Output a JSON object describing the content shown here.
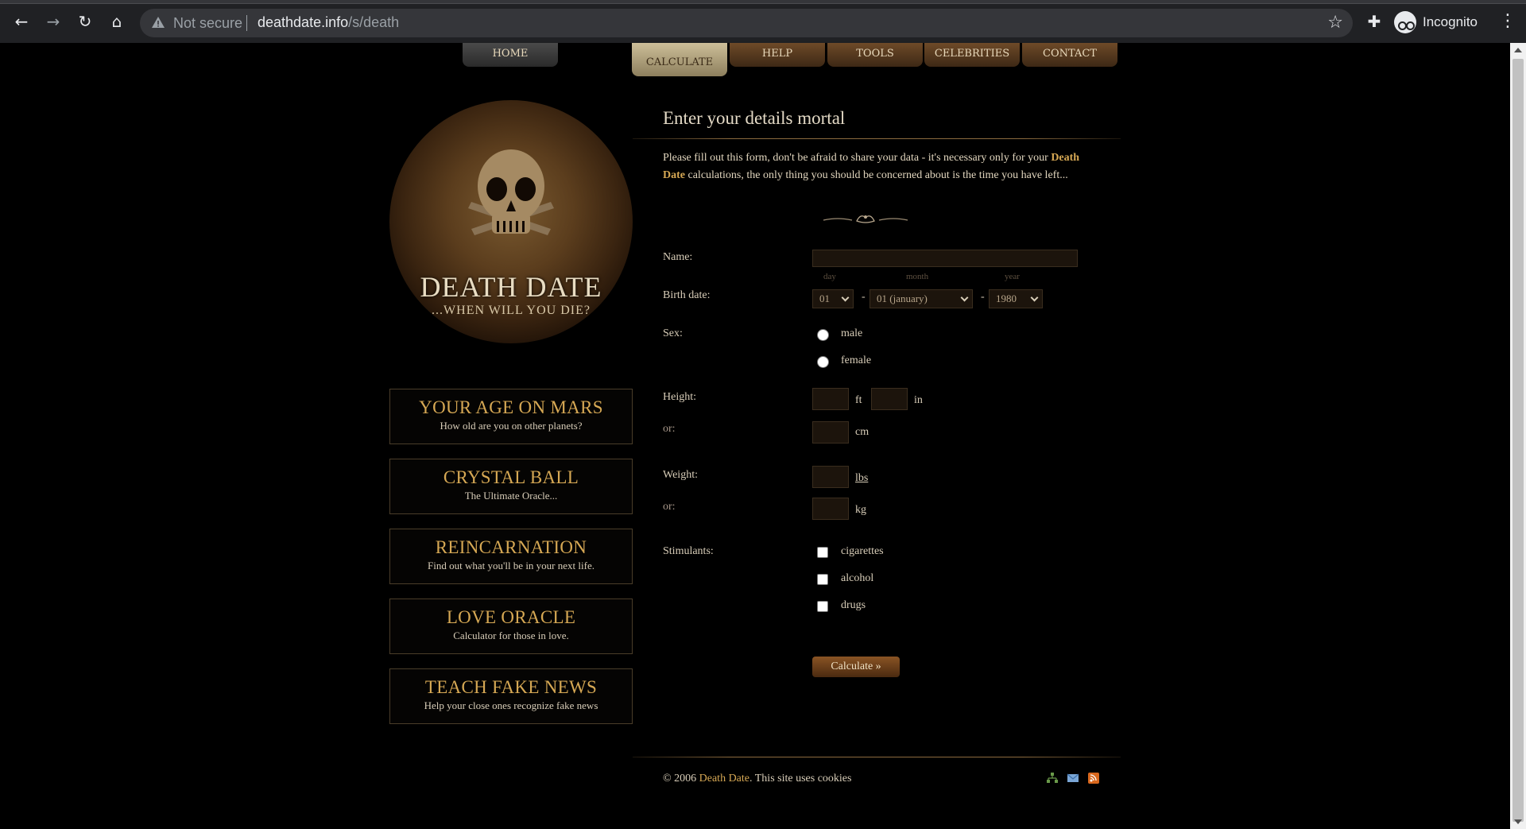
{
  "browser": {
    "security_label": "Not secure",
    "url_domain": "deathdate.info",
    "url_path": "/s/death",
    "profile_label": "Incognito"
  },
  "nav": {
    "tabs": [
      {
        "label": "HOME"
      },
      {
        "label": "CALCULATE"
      },
      {
        "label": "HELP"
      },
      {
        "label": "TOOLS"
      },
      {
        "label": "CELEBRITIES"
      },
      {
        "label": "CONTACT"
      }
    ]
  },
  "logo": {
    "title": "DEATH DATE",
    "subtitle": "...WHEN WILL YOU DIE?"
  },
  "promos": [
    {
      "title": "YOUR AGE ON MARS",
      "subtitle": "How old are you on other planets?"
    },
    {
      "title": "CRYSTAL BALL",
      "subtitle": "The Ultimate Oracle..."
    },
    {
      "title": "REINCARNATION",
      "subtitle": "Find out what you'll be in your next life."
    },
    {
      "title": "LOVE ORACLE",
      "subtitle": "Calculator for those in love."
    },
    {
      "title": "TEACH FAKE NEWS",
      "subtitle": "Help your close ones recognize fake news"
    }
  ],
  "form": {
    "heading": "Enter your details mortal",
    "intro_part1": "Please fill out this form, don't be afraid to share your data - it's necessary only for your ",
    "intro_highlight": "Death Date",
    "intro_part2": " calculations, the only thing you should be concerned about is the time you have left...",
    "name_label": "Name:",
    "name_value": "",
    "birth_label": "Birth date:",
    "day_hint": "day",
    "month_hint": "month",
    "year_hint": "year",
    "day_value": "01",
    "month_value": "01 (january)",
    "year_value": "1980",
    "dash": "-",
    "sex_label": "Sex:",
    "male_label": "male",
    "female_label": "female",
    "height_label": "Height:",
    "ft_unit": "ft",
    "in_unit": "in",
    "or_label": "or:",
    "cm_unit": "cm",
    "weight_label": "Weight:",
    "lbs_unit": "lbs",
    "kg_unit": "kg",
    "stimulants_label": "Stimulants:",
    "cigarettes_label": "cigarettes",
    "alcohol_label": "alcohol",
    "drugs_label": "drugs",
    "submit_label": "Calculate »"
  },
  "footer": {
    "copyright": "© 2006",
    "brand": "Death Date",
    "cookies": ". This site uses cookies"
  },
  "colors": {
    "accent": "#d6a854",
    "background": "#000000",
    "text": "#d8cdb8"
  }
}
